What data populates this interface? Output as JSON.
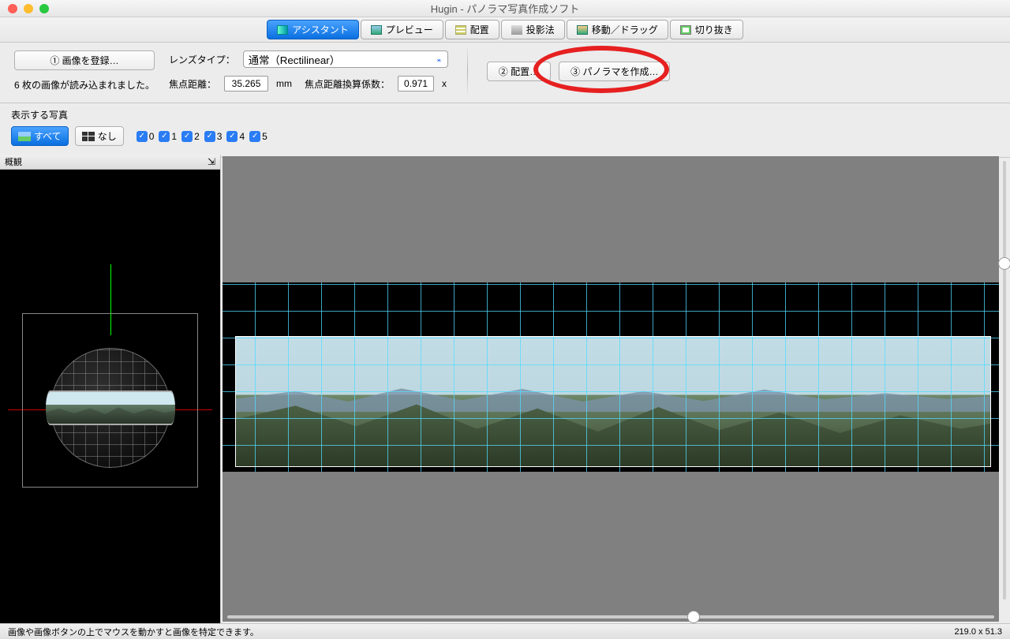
{
  "window": {
    "title": "Hugin - パノラマ写真作成ソフト"
  },
  "tabs": {
    "assistant": "アシスタント",
    "preview": "プレビュー",
    "layout": "配置",
    "projection": "投影法",
    "move": "移動／ドラッグ",
    "crop": "切り抜き"
  },
  "toolbar": {
    "load_images": "① 画像を登録…",
    "load_status": "6 枚の画像が読み込まれました。",
    "lens_type_label": "レンズタイプ：",
    "lens_type_value": "通常（Rectilinear）",
    "focal_length_label": "焦点距離：",
    "focal_length_value": "35.265",
    "focal_unit": "mm",
    "crop_factor_label": "焦点距離換算係数：",
    "crop_factor_value": "0.971",
    "crop_factor_suffix": "x",
    "align": "② 配置…",
    "create": "③ パノラマを作成…"
  },
  "photos": {
    "section_label": "表示する写真",
    "all": "すべて",
    "none": "なし",
    "items": [
      "0",
      "1",
      "2",
      "3",
      "4",
      "5"
    ]
  },
  "side": {
    "title": "概観"
  },
  "status": {
    "hint": "画像や画像ボタンの上でマウスを動かすと画像を特定できます。",
    "coords": "219.0 x 51.3"
  }
}
